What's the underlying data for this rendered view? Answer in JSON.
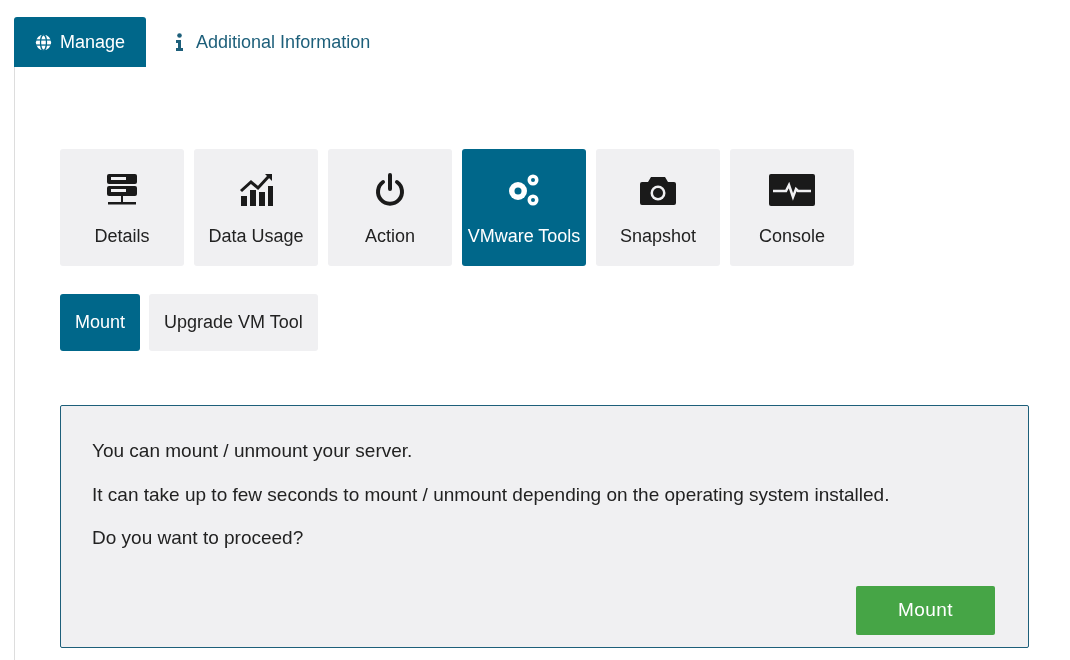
{
  "tabs": [
    {
      "label": "Manage",
      "selected": true
    },
    {
      "label": "Additional Information",
      "selected": false
    }
  ],
  "tiles": [
    {
      "label": "Details",
      "selected": false
    },
    {
      "label": "Data Usage",
      "selected": false
    },
    {
      "label": "Action",
      "selected": false
    },
    {
      "label": "VMware Tools",
      "selected": true
    },
    {
      "label": "Snapshot",
      "selected": false
    },
    {
      "label": "Console",
      "selected": false
    }
  ],
  "subtabs": [
    {
      "label": "Mount",
      "selected": true
    },
    {
      "label": "Upgrade VM Tool",
      "selected": false
    }
  ],
  "panel": {
    "lines": [
      "You can mount / unmount your server.",
      "It can take up to few seconds to mount / unmount depending on the operating system installed.",
      "Do you want to proceed?"
    ],
    "button": "Mount"
  }
}
